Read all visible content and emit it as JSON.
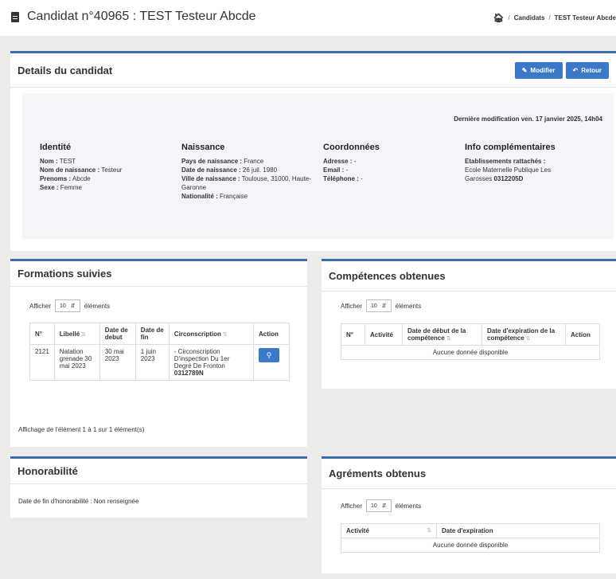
{
  "header": {
    "title": "Candidat n°40965 : TEST Testeur Abcde",
    "breadcrumb": [
      "Candidats",
      "TEST Testeur Abcde"
    ]
  },
  "details": {
    "title": "Details du candidat",
    "modify_label": "Modifier",
    "back_label": "Retour",
    "last_modified": "Dernière modification ven. 17 janvier 2025, 14h04",
    "identite": {
      "title": "Identité",
      "nom_label": "Nom :",
      "nom": " TEST",
      "nom_naissance_label": "Nom de naissance :",
      "nom_naissance": " Testeur",
      "prenoms_label": "Prenoms :",
      "prenoms": " Abcde",
      "sexe_label": "Sexe :",
      "sexe": " Femme"
    },
    "naissance": {
      "title": "Naissance",
      "pays_label": "Pays de naissance :",
      "pays": " France",
      "date_label": "Date de naissance :",
      "date": " 26 juil. 1980",
      "ville_label": "Ville de naissance :",
      "ville": " Toulouse, 31000, Haute-Garonne",
      "nationalite_label": "Nationalité :",
      "nationalite": " Française"
    },
    "coordonnees": {
      "title": "Coordonnées",
      "adresse_label": "Adresse :",
      "adresse": " -",
      "email_label": "Email :",
      "email": " -",
      "telephone_label": "Téléphone :",
      "telephone": " -"
    },
    "info": {
      "title": "Info complémentaires",
      "etab_label": "Etablissements rattachés :",
      "etab_name": "Ecole Maternelle Publique Les Garosses ",
      "etab_code": "0312205D"
    }
  },
  "formations": {
    "title": "Formations suivies",
    "show_label": "Afficher",
    "page_size": "10",
    "elements_label": "éléments",
    "columns": [
      "N°",
      "Libellé",
      "Date de debut",
      "Date de fin",
      "Circonscription",
      "Action"
    ],
    "rows": [
      {
        "num": "2121",
        "libelle": "Natation grenade 30 mai 2023",
        "debut": "30 mai 2023",
        "fin": "1 juin 2023",
        "circ": "- Circonscription D'inspection Du 1er Degré De Fronton",
        "circ_code": "0312789N"
      }
    ],
    "info": "Affichage de l'élément 1 à 1 sur 1 élément(s)"
  },
  "competences": {
    "title": "Compétences obtenues",
    "show_label": "Afficher",
    "page_size": "10",
    "elements_label": "éléments",
    "columns": [
      "N°",
      "Activité",
      "Date de début de la compétence",
      "Date d'expiration de la compétence",
      "Action"
    ],
    "empty": "Aucune donnée disponible"
  },
  "honorabilite": {
    "title": "Honorabilité",
    "label": "Date de fin d'honorabilité :",
    "value": " Non renseignée"
  },
  "agrements": {
    "title": "Agréments obtenus",
    "show_label": "Afficher",
    "page_size": "10",
    "elements_label": "éléments",
    "columns": [
      "Activité",
      "Date d'expiration"
    ],
    "empty": "Aucune donnée disponible"
  }
}
